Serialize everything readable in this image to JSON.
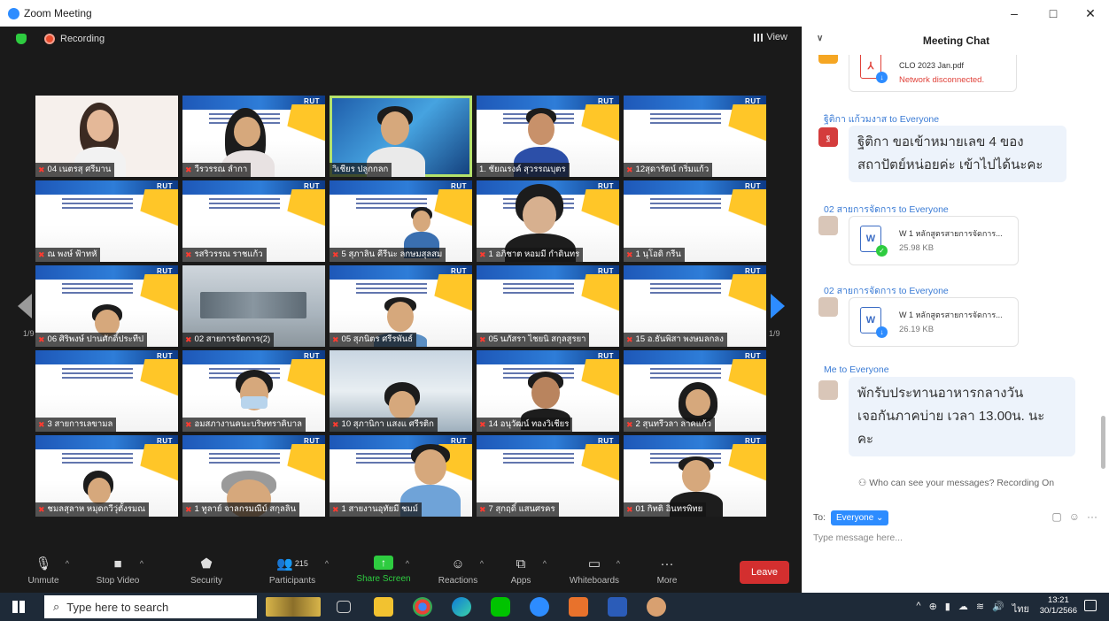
{
  "window": {
    "title": "Zoom Meeting",
    "controls": [
      "–",
      "□",
      "✕"
    ]
  },
  "meeting": {
    "recording_label": "Recording",
    "view_label": "View",
    "page_indicator_left": "1/9",
    "page_indicator_right": "1/9",
    "participants": [
      "04 เนตรสุ ศรีมาน",
      "วีรวรรณ ลำกา",
      "วิเชียร ปลูกกลก",
      "1. ชัยณรงค์ สุวรรณบุตร",
      "12สุดารัตน์ กริ่มแก้ว",
      "ณ พงษ์ ฟ้าทหั",
      "รสริวรรณ ราชแก้ว",
      "5 สุภาลิน คีรีนะ ลกษมสุลสม",
      "1 อภิชาต หอมมี กำดินทร",
      "1 นุโอดิ กรีน",
      "06 ศิริพงษ์ ปานศักดิ์ประทีป",
      "02 สายการจัดการ(2)",
      "05 สุภนิตร ศรีรพันธ์",
      "05 นภัสรา ไชยนิ สกุลสูรยา",
      "15 อ.ธันพิสา พงษมลกลง",
      "3 สายการเลขามล",
      "อมสภางานคนะบริษทราคิบาล",
      "10 สุภานิกา แสงแ ศรีรติก",
      "14 อนุวัฒน์ ทองวิเชียร",
      "2 สุนทรีวลา ลาคแก้ว",
      "ชมลสุลาห หมุดกวีวุ่ตั้งรมณ",
      "1 ทูลาย์ จาลกรมณีบ์ สกุลลิน",
      "1 สายงานอุทัยมี ชมม์",
      "7 สุกฤดิ์ แสนศรคร",
      "01 กิทติ อินทรพิทย"
    ]
  },
  "toolbar": {
    "unmute": "Unmute",
    "stop_video": "Stop Video",
    "security": "Security",
    "participants": "Participants",
    "participants_count": "215",
    "share_screen": "Share Screen",
    "reactions": "Reactions",
    "apps": "Apps",
    "whiteboards": "Whiteboards",
    "more": "More",
    "leave": "Leave"
  },
  "chat": {
    "header": "Meeting Chat",
    "messages": [
      {
        "file_name": "CLO 2023 Jan.pdf",
        "file_status": "Network disconnected."
      },
      {
        "sender": "ฐิติกา แก้วมงาส to Everyone",
        "avatar_letter": "ฐ",
        "text_line1": "ฐิติกา ขอเข้าหมายเลข 4 ของ",
        "text_line2": "สถาปัตย์หน่อยค่ะ เข้าไปได้นะคะ"
      },
      {
        "sender": "02 สายการจัดการ to Everyone",
        "file_name": "W 1 หลักสูตรสายการจัดการ...",
        "file_size": "25.98 KB"
      },
      {
        "sender": "02 สายการจัดการ to Everyone",
        "file_name": "W 1 หลักสูตรสายการจัดการ...",
        "file_size": "26.19 KB"
      },
      {
        "sender": "Me to Everyone",
        "text_line1": "พักรับประทานอาหารกลางวัน",
        "text_line2": "เจอกันภาคบ่าย เวลา 13.00น. นะ",
        "text_line3": "คะ"
      }
    ],
    "privacy_note": "Who can see your messages? Recording On",
    "to_label": "To:",
    "to_value": "Everyone ⌄",
    "input_placeholder": "Type message here..."
  },
  "taskbar": {
    "search_placeholder": "Type here to search",
    "time": "13:21",
    "date": "30/1/2566",
    "lang": "ไทย"
  },
  "colors": {
    "accent": "#2d8cff",
    "leave": "#d32f2f",
    "share": "#2ecc40",
    "chat_bubble": "#edf3fb"
  }
}
